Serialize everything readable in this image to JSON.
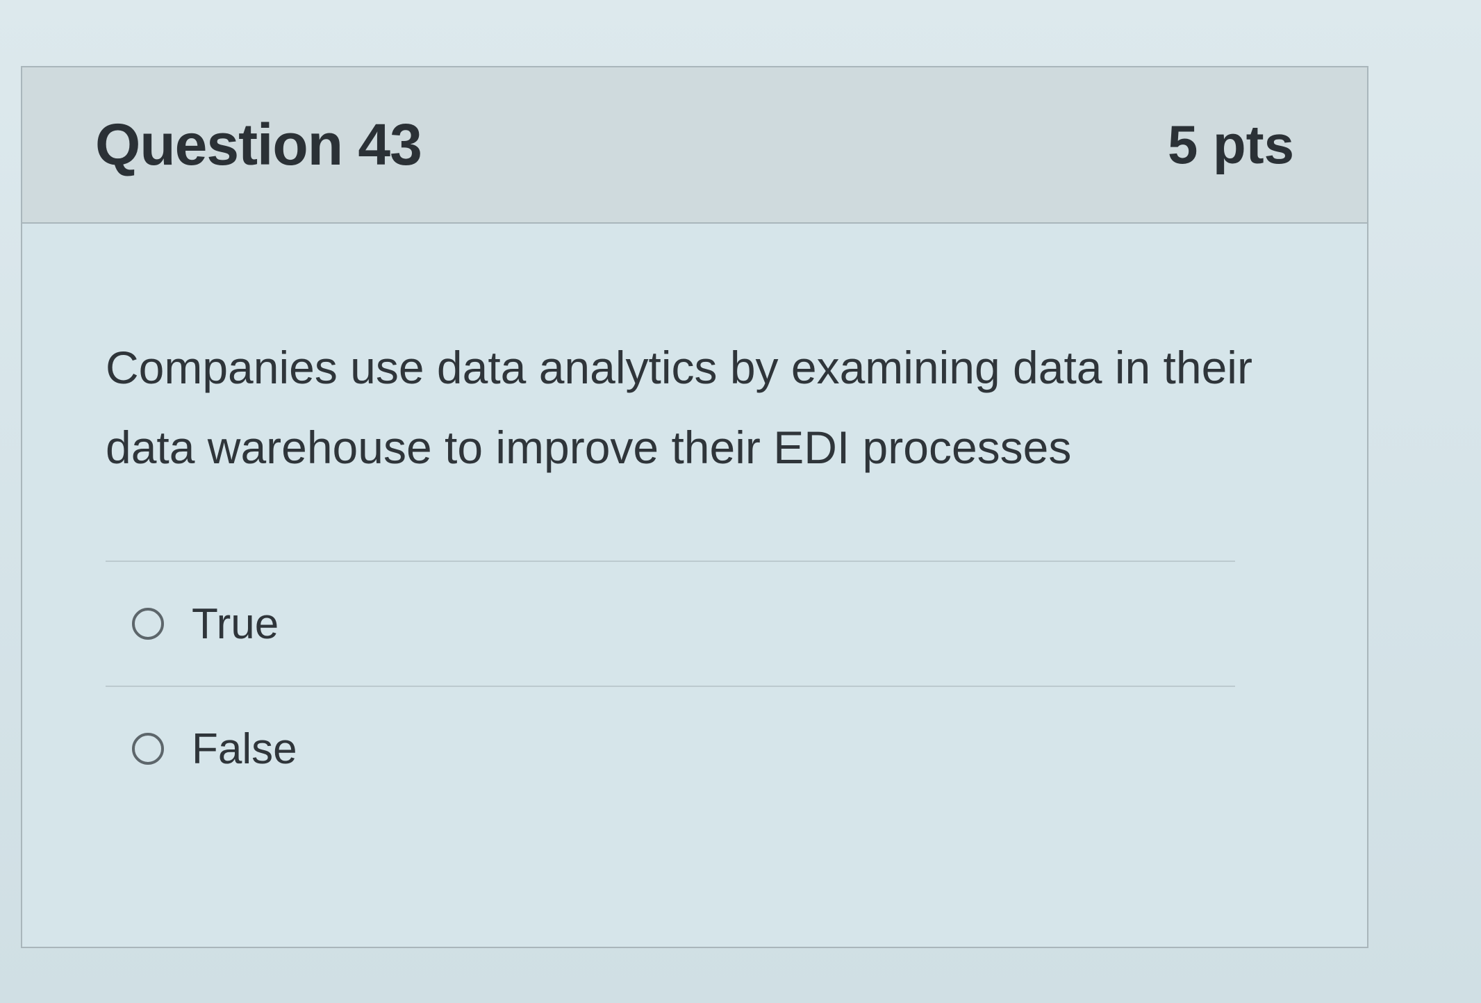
{
  "question": {
    "title": "Question 43",
    "points": "5 pts",
    "text": "Companies use data analytics by examining data in their data warehouse to improve their EDI processes",
    "answers": [
      {
        "label": "True",
        "icon": "radio-unchecked-icon"
      },
      {
        "label": "False",
        "icon": "radio-unchecked-icon"
      }
    ]
  }
}
